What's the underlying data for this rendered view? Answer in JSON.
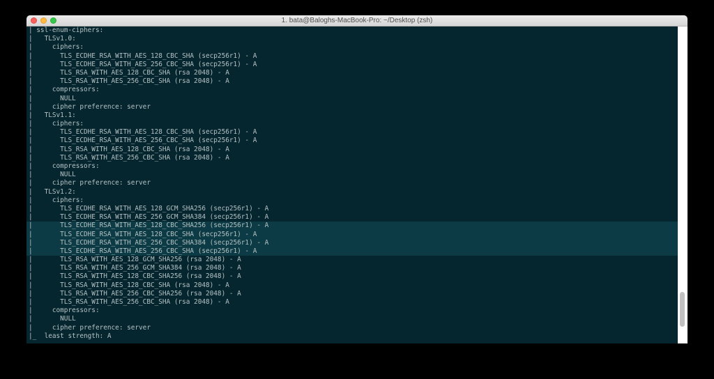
{
  "window": {
    "title": "1. bata@Baloghs-MacBook-Pro: ~/Desktop (zsh)"
  },
  "terminal": {
    "lines": [
      "| ssl-enum-ciphers:",
      "|   TLSv1.0:",
      "|     ciphers:",
      "|       TLS_ECDHE_RSA_WITH_AES_128_CBC_SHA (secp256r1) - A",
      "|       TLS_ECDHE_RSA_WITH_AES_256_CBC_SHA (secp256r1) - A",
      "|       TLS_RSA_WITH_AES_128_CBC_SHA (rsa 2048) - A",
      "|       TLS_RSA_WITH_AES_256_CBC_SHA (rsa 2048) - A",
      "|     compressors:",
      "|       NULL",
      "|     cipher preference: server",
      "|   TLSv1.1:",
      "|     ciphers:",
      "|       TLS_ECDHE_RSA_WITH_AES_128_CBC_SHA (secp256r1) - A",
      "|       TLS_ECDHE_RSA_WITH_AES_256_CBC_SHA (secp256r1) - A",
      "|       TLS_RSA_WITH_AES_128_CBC_SHA (rsa 2048) - A",
      "|       TLS_RSA_WITH_AES_256_CBC_SHA (rsa 2048) - A",
      "|     compressors:",
      "|       NULL",
      "|     cipher preference: server",
      "|   TLSv1.2:",
      "|     ciphers:",
      "|       TLS_ECDHE_RSA_WITH_AES_128_GCM_SHA256 (secp256r1) - A",
      "|       TLS_ECDHE_RSA_WITH_AES_256_GCM_SHA384 (secp256r1) - A",
      "|       TLS_ECDHE_RSA_WITH_AES_128_CBC_SHA256 (secp256r1) - A",
      "|       TLS_ECDHE_RSA_WITH_AES_128_CBC_SHA (secp256r1) - A",
      "|       TLS_ECDHE_RSA_WITH_AES_256_CBC_SHA384 (secp256r1) - A",
      "|       TLS_ECDHE_RSA_WITH_AES_256_CBC_SHA (secp256r1) - A",
      "|       TLS_RSA_WITH_AES_128_GCM_SHA256 (rsa 2048) - A",
      "|       TLS_RSA_WITH_AES_256_GCM_SHA384 (rsa 2048) - A",
      "|       TLS_RSA_WITH_AES_128_CBC_SHA256 (rsa 2048) - A",
      "|       TLS_RSA_WITH_AES_128_CBC_SHA (rsa 2048) - A",
      "|       TLS_RSA_WITH_AES_256_CBC_SHA256 (rsa 2048) - A",
      "|       TLS_RSA_WITH_AES_256_CBC_SHA (rsa 2048) - A",
      "|     compressors:",
      "|       NULL",
      "|     cipher preference: server",
      "|_  least strength: A"
    ],
    "highlighted_lines": [
      23,
      24,
      25,
      26
    ]
  },
  "scrollbar": {
    "visible_fraction": 0.11,
    "position_fraction": 0.94
  },
  "colors": {
    "terminal_background": "#06262f",
    "terminal_text": "#b4c2c4",
    "selection_background": "#0d3b45",
    "close_button": "#fc615d",
    "minimize_button": "#fdbc40",
    "maximize_button": "#34c84a"
  }
}
